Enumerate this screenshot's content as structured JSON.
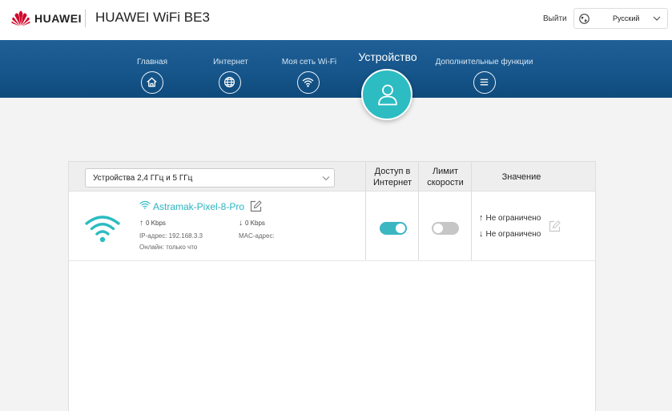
{
  "header": {
    "brand": "HUAWEI",
    "product": "HUAWEI WiFi BE3",
    "logout": "Выйти",
    "language": "Русский",
    "icons": {
      "logo": "huawei-logo-icon",
      "globe": "globe-icon",
      "chevron": "chevron-down-icon"
    }
  },
  "nav": {
    "items": [
      {
        "label": "Главная",
        "icon": "home-icon"
      },
      {
        "label": "Интернет",
        "icon": "globe-icon"
      },
      {
        "label": "Моя сеть Wi-Fi",
        "icon": "wifi-icon"
      },
      {
        "label": "Дополнительные функции",
        "icon": "menu-icon"
      }
    ],
    "active": {
      "label": "Устройство",
      "icon": "user-icon"
    }
  },
  "devices": {
    "filter": "Устройства 2,4 ГГц и 5 ГГц",
    "columns": {
      "access": "Доступ в Интернет",
      "access_l1": "Доступ в",
      "access_l2": "Интернет",
      "limit_l1": "Лимит",
      "limit_l2": "скорости",
      "value": "Значение"
    },
    "rows": [
      {
        "name": "Astramak-Pixel-8-Pro",
        "upload": "0 Kbps",
        "download": "0 Kbps",
        "ip": "IP-адрес: 192.168.3.3",
        "mac": "MAC-адрес:",
        "online": "Онлайн: только что",
        "internet_access": true,
        "speed_limit": false,
        "limit_up": "Не ограничено",
        "limit_down": "Не ограничено"
      }
    ]
  },
  "colors": {
    "accent": "#2cbcc2",
    "nav": "#16568b",
    "link": "#2bb3bf"
  }
}
